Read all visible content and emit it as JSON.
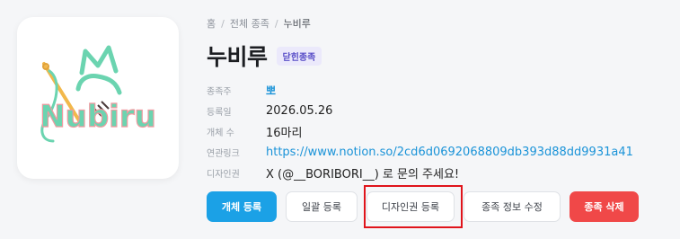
{
  "breadcrumb": {
    "home": "홈",
    "all": "전체 종족",
    "current": "누비루"
  },
  "title": "누비루",
  "badge": "닫힌종족",
  "logo_text": "Nubiru",
  "meta": [
    {
      "label": "종족주",
      "value": "뽀"
    },
    {
      "label": "등록일",
      "value": "2026.05.26"
    },
    {
      "label": "개체 수",
      "value": "16마리"
    },
    {
      "label": "연관링크",
      "value": "https://www.notion.so/2cd6d0692068809db393d88dd9931a41"
    },
    {
      "label": "디자인권",
      "value": "X (@__BORIBORI__) 로 문의 주세요!"
    }
  ],
  "buttons": {
    "register": "개체 등록",
    "bulk": "일괄 등록",
    "design": "디자인권 등록",
    "edit": "종족 정보 수정",
    "delete": "종족 삭제"
  },
  "colors": {
    "accent": "#1ba1e6",
    "danger": "#f04848",
    "highlight": "#e0141b",
    "badge_bg": "#ebe9fb"
  }
}
